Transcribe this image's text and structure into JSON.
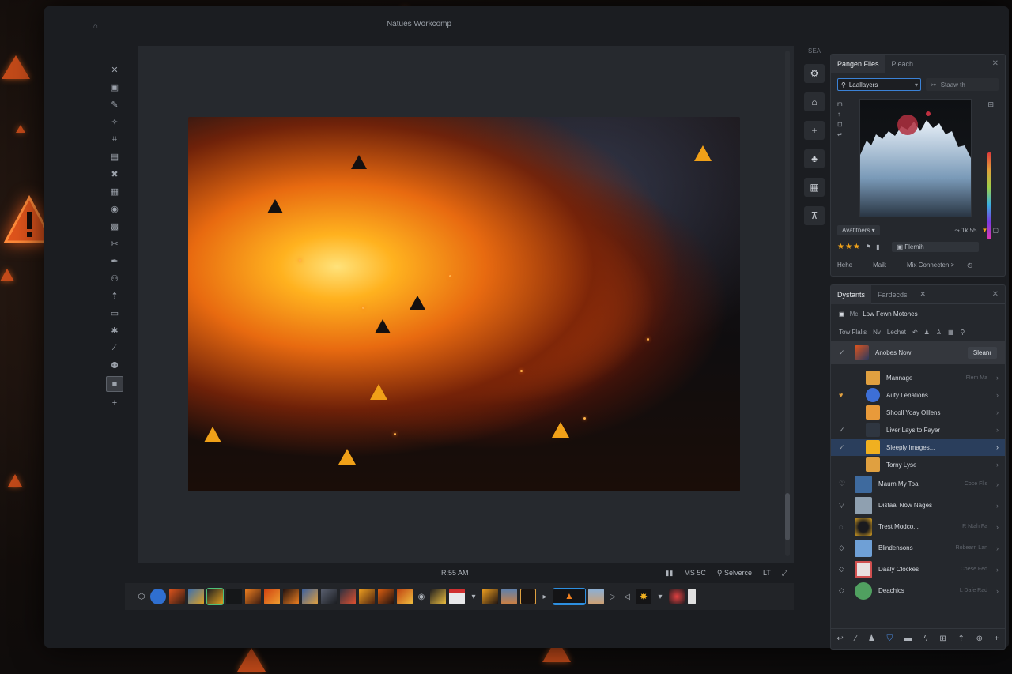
{
  "window": {
    "title": "Natues Workcomp"
  },
  "toolbar": {
    "tools": [
      "move-icon",
      "brush-icon",
      "wand-icon",
      "crop-icon",
      "layers-icon",
      "close-x-icon",
      "stamp-icon",
      "bubble-icon",
      "bag-icon",
      "scissors-icon",
      "pen-icon",
      "people-icon",
      "pin-icon",
      "monitor-icon",
      "bug-icon",
      "feather-icon",
      "figures-icon"
    ],
    "active_tool": "layer-square-icon"
  },
  "status": {
    "time": "R:55 AM",
    "ms": "MS 5C",
    "selverce": "Selverce",
    "ctrl": "LT"
  },
  "midcol": {
    "label": "SEA"
  },
  "panel1": {
    "tabs": [
      "Pangen Files",
      "Pleach"
    ],
    "search_value": "Laallayers",
    "search2_placeholder": "Staaw th",
    "histogram_label": "Avatitners",
    "value_readout": "1k.55",
    "rating": "★★★",
    "filter_label": "Flernih",
    "footer": [
      "Hehe",
      "Maik",
      "Mix Connecten >"
    ]
  },
  "panel2": {
    "tabs": [
      "Dystants",
      "Fardecds"
    ],
    "header": "Low Fewn Motohes",
    "filters": [
      "Tow Flalis",
      "Nv",
      "Lechet"
    ],
    "items": [
      {
        "label": "Anobes Now",
        "action": "Sleanr",
        "check": "✓",
        "sub": "",
        "color": "#c55a2a"
      },
      {
        "label": "Mannage",
        "check": "",
        "sub": "Flem Ma",
        "color": "#e0a040"
      },
      {
        "label": "Auty Lenations",
        "check": "♥",
        "sub": "",
        "color": "#3d6fd6"
      },
      {
        "label": "Shooll Yoay Olllens",
        "check": "",
        "sub": "",
        "color": "#e89a3a"
      },
      {
        "label": "Liver Lays to Fayer",
        "check": "✓",
        "sub": "",
        "color": "#2f3640"
      },
      {
        "label": "Sleeply Images...",
        "check": "✓",
        "sub": "",
        "color": "#f0b020"
      },
      {
        "label": "Torny Lyse",
        "check": "",
        "sub": "",
        "color": "#e0a040"
      },
      {
        "label": "Maurn My Toal",
        "check": "♡",
        "sub": "Coce Flis",
        "color": "#3e6a9e"
      },
      {
        "label": "Distaal Now Nages",
        "check": "▽",
        "sub": "",
        "color": "#8fa0b0"
      },
      {
        "label": "Trest Modco...",
        "check": "◌",
        "sub": "R Ntah Fa",
        "color": "#d8a020"
      },
      {
        "label": "Blindensons",
        "check": "◇",
        "sub": "Robearn Lan",
        "color": "#6fa0d6"
      },
      {
        "label": "Daaly Clockes",
        "check": "◇",
        "sub": "Coese Fed",
        "color": "#d05050"
      },
      {
        "label": "Deachics",
        "check": "◇",
        "sub": "L Dafe Rad",
        "color": "#50a060"
      }
    ]
  },
  "colors": {
    "accent": "#2d8fe0",
    "warning": "#e0541c",
    "selection": "#2a3e5c"
  }
}
